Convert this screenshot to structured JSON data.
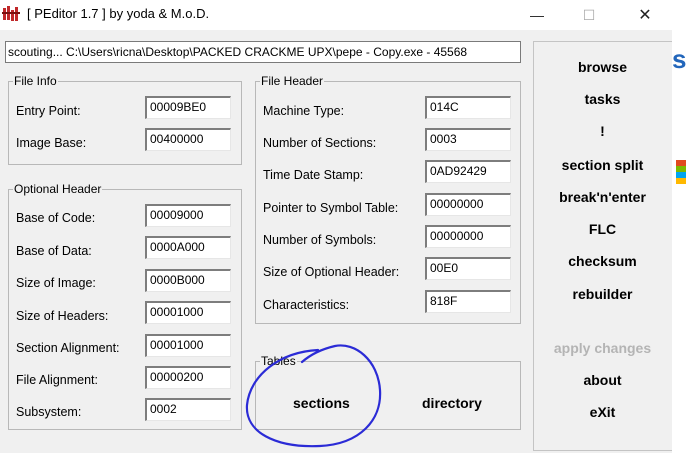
{
  "window": {
    "title": "[ PEditor 1.7 ]  by yoda & M.o.D.",
    "minimize_glyph": "—",
    "maximize_glyph": "☐",
    "close_glyph": "✕"
  },
  "path_bar": {
    "value": "scouting... C:\\Users\\ricna\\Desktop\\PACKED CRACKME UPX\\pepe - Copy.exe - 45568"
  },
  "file_info": {
    "title": "File Info",
    "fields": [
      {
        "label": "Entry Point:",
        "value": "00009BE0"
      },
      {
        "label": "Image Base:",
        "value": "00400000"
      }
    ]
  },
  "optional_header": {
    "title": "Optional Header",
    "fields": [
      {
        "label": "Base of Code:",
        "value": "00009000"
      },
      {
        "label": "Base of Data:",
        "value": "0000A000"
      },
      {
        "label": "Size of Image:",
        "value": "0000B000"
      },
      {
        "label": "Size of Headers:",
        "value": "00001000"
      },
      {
        "label": "Section Alignment:",
        "value": "00001000"
      },
      {
        "label": "File Alignment:",
        "value": "00000200"
      },
      {
        "label": "Subsystem:",
        "value": "0002"
      }
    ]
  },
  "file_header": {
    "title": "File Header",
    "fields": [
      {
        "label": "Machine Type:",
        "value": "014C"
      },
      {
        "label": "Number of Sections:",
        "value": "0003"
      },
      {
        "label": "Time Date Stamp:",
        "value": "0AD92429"
      },
      {
        "label": "Pointer to Symbol Table:",
        "value": "00000000"
      },
      {
        "label": "Number of Symbols:",
        "value": "00000000"
      },
      {
        "label": "Size of Optional Header:",
        "value": "00E0"
      },
      {
        "label": "Characteristics:",
        "value": "818F"
      }
    ]
  },
  "tables": {
    "title": "Tables",
    "sections_label": "sections",
    "directory_label": "directory"
  },
  "side_buttons": {
    "browse": "browse",
    "tasks": "tasks",
    "bang": "!",
    "section_split": "section split",
    "break_n_enter": "break'n'enter",
    "flc": "FLC",
    "checksum": "checksum",
    "rebuilder": "rebuilder",
    "apply_changes": "apply changes",
    "about": "about",
    "exit": "eXit"
  },
  "annotation": {
    "color": "#2b2bd6"
  },
  "background_partial": {
    "letter": "s"
  }
}
